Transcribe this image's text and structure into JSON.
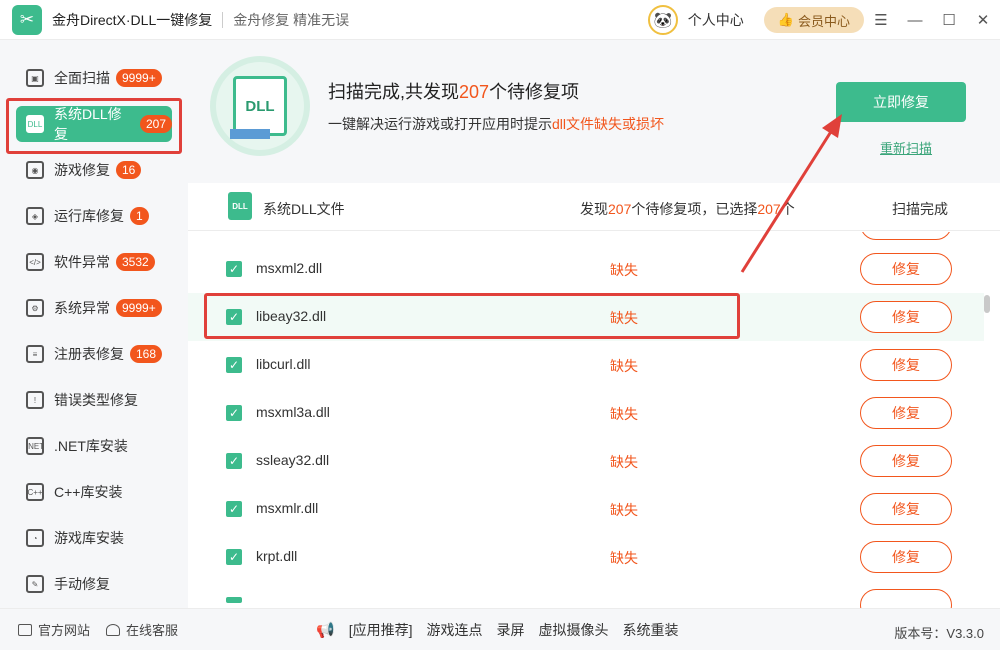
{
  "titlebar": {
    "logo_glyph": "✂",
    "title": "金舟DirectX·DLL一键修复",
    "slogan": "金舟修复 精准无误",
    "avatar_glyph": "🐼",
    "personal_center": "个人中心",
    "vip_center": "会员中心",
    "menu_glyph": "☰",
    "minimize_glyph": "—",
    "maximize_glyph": "☐",
    "close_glyph": "✕"
  },
  "sidebar": {
    "items": [
      {
        "label": "全面扫描",
        "badge": "9999+",
        "icon": "scan-icon",
        "glyph": "▣"
      },
      {
        "label": "系统DLL修复",
        "badge": "207",
        "icon": "dll-icon",
        "glyph": "DLL"
      },
      {
        "label": "游戏修复",
        "badge": "16",
        "icon": "gamepad-icon",
        "glyph": "◉"
      },
      {
        "label": "运行库修复",
        "badge": "1",
        "icon": "runtime-icon",
        "glyph": "◈"
      },
      {
        "label": "软件异常",
        "badge": "3532",
        "icon": "code-icon",
        "glyph": "</>"
      },
      {
        "label": "系统异常",
        "badge": "9999+",
        "icon": "gear-icon",
        "glyph": "⚙"
      },
      {
        "label": "注册表修复",
        "badge": "168",
        "icon": "list-icon",
        "glyph": "≡"
      },
      {
        "label": "错误类型修复",
        "badge": "",
        "icon": "warning-icon",
        "glyph": "!"
      },
      {
        "label": ".NET库安装",
        "badge": "",
        "icon": "net-icon",
        "glyph": ".NET"
      },
      {
        "label": "C++库安装",
        "badge": "",
        "icon": "cpp-icon",
        "glyph": "C++"
      },
      {
        "label": "游戏库安装",
        "badge": "",
        "icon": "pacman-icon",
        "glyph": "◔"
      },
      {
        "label": "手动修复",
        "badge": "",
        "icon": "wrench-icon",
        "glyph": "✎"
      }
    ]
  },
  "header": {
    "dll_label": "DLL",
    "title_prefix": "扫描完成,共发现",
    "count": "207",
    "title_suffix": "个待修复项",
    "sub_prefix": "一键解决运行游戏或打开应用时提示",
    "sub_highlight": "dll文件缺失或损坏",
    "repair_now": "立即修复",
    "rescan": "重新扫描"
  },
  "list_header": {
    "icon_text": "DLL",
    "name": "系统DLL文件",
    "found_prefix": "发现",
    "found_count": "207",
    "found_mid": "个待修复项，已选择",
    "selected_count": "207",
    "found_suffix": "个",
    "status": "扫描完成"
  },
  "rows": [
    {
      "name": "msxml2.dll",
      "status": "缺失",
      "action": "修复"
    },
    {
      "name": "libeay32.dll",
      "status": "缺失",
      "action": "修复"
    },
    {
      "name": "libcurl.dll",
      "status": "缺失",
      "action": "修复"
    },
    {
      "name": "msxml3a.dll",
      "status": "缺失",
      "action": "修复"
    },
    {
      "name": "ssleay32.dll",
      "status": "缺失",
      "action": "修复"
    },
    {
      "name": "msxmlr.dll",
      "status": "缺失",
      "action": "修复"
    },
    {
      "name": "krpt.dll",
      "status": "缺失",
      "action": "修复"
    }
  ],
  "checkmark": "✓",
  "footer": {
    "official_site": "官方网站",
    "online_service": "在线客服",
    "speaker_glyph": "📢",
    "app_recommend": "[应用推荐]",
    "links": [
      "游戏连点",
      "录屏",
      "虚拟摄像头",
      "系统重装"
    ],
    "version": "版本号：V3.3.0"
  },
  "colors": {
    "accent": "#3dbb8d",
    "warning": "#f2561d",
    "annotation": "#e0403a"
  }
}
